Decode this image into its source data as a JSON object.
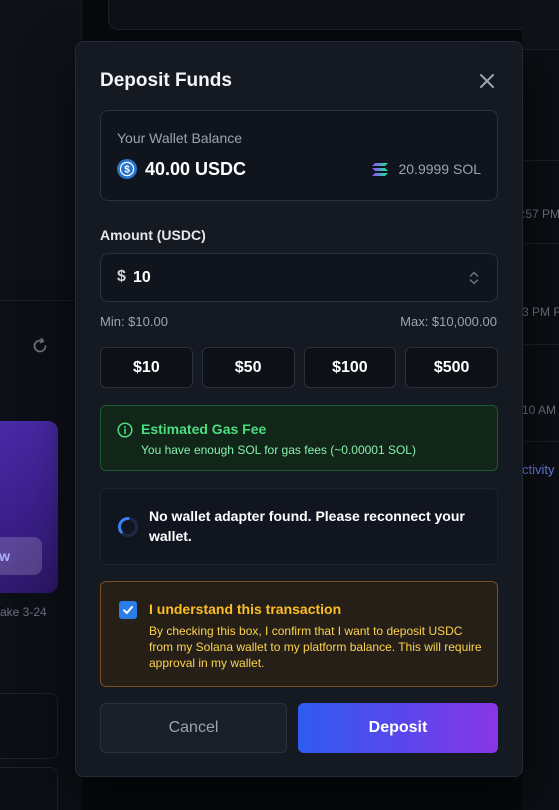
{
  "background": {
    "stake_text": "ake 3-24",
    "purple_button_label": "w",
    "right_times": [
      ":57 PM",
      "3 PM F",
      "10 AM"
    ],
    "right_link": "ctivity"
  },
  "modal": {
    "title": "Deposit Funds",
    "wallet": {
      "label": "Your Wallet Balance",
      "usdc_balance": "40.00 USDC",
      "sol_balance": "20.9999 SOL"
    },
    "amount": {
      "label": "Amount (USDC)",
      "currency_symbol": "$",
      "value": "10",
      "min": "Min: $10.00",
      "max": "Max: $10,000.00"
    },
    "quick_amounts": [
      "$10",
      "$50",
      "$100",
      "$500"
    ],
    "gas": {
      "title": "Estimated Gas Fee",
      "description": "You have enough SOL for gas fees (~0.00001 SOL)"
    },
    "adapter_message": "No wallet adapter found. Please reconnect your wallet.",
    "confirm": {
      "checked": true,
      "title": "I understand this transaction",
      "description": "By checking this box, I confirm that I want to deposit USDC from my Solana wallet to my platform balance. This will require approval in my wallet."
    },
    "buttons": {
      "cancel": "Cancel",
      "deposit": "Deposit"
    }
  },
  "colors": {
    "accent_blue": "#2f5cf0",
    "accent_purple": "#8a36e6",
    "success_green": "#4ade80",
    "warning_amber": "#fbbf24"
  },
  "icons": [
    "close-icon",
    "usdc-icon",
    "solana-icon",
    "stepper-icon",
    "info-icon",
    "spinner-icon",
    "checkmark-icon",
    "refresh-icon"
  ]
}
